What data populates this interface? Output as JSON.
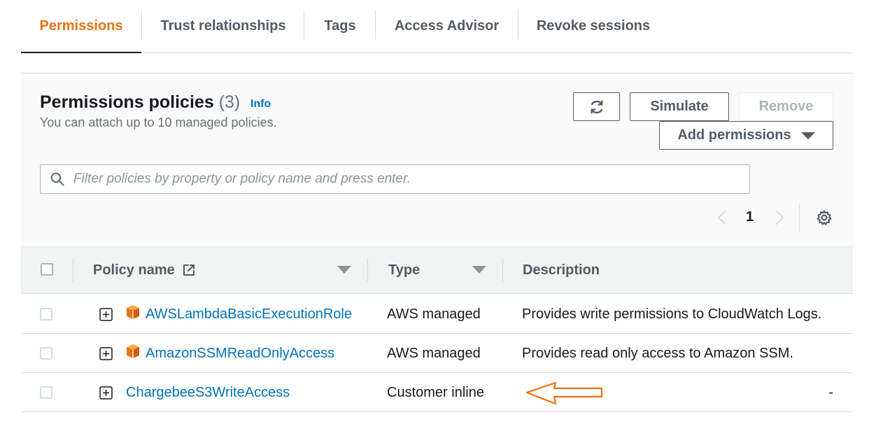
{
  "tabs": [
    {
      "label": "Permissions",
      "active": true
    },
    {
      "label": "Trust relationships",
      "active": false
    },
    {
      "label": "Tags",
      "active": false
    },
    {
      "label": "Access Advisor",
      "active": false
    },
    {
      "label": "Revoke sessions",
      "active": false
    }
  ],
  "policies": {
    "title": "Permissions policies",
    "count": "(3)",
    "info_label": "Info",
    "subtitle": "You can attach up to 10 managed policies.",
    "buttons": {
      "refresh_icon": "refresh-icon",
      "simulate": "Simulate",
      "remove": "Remove",
      "add_permissions": "Add permissions"
    },
    "search": {
      "placeholder": "Filter policies by property or policy name and press enter.",
      "value": ""
    },
    "pagination": {
      "current_page": "1"
    },
    "columns": {
      "policy_name": "Policy name",
      "type": "Type",
      "description": "Description"
    },
    "rows": [
      {
        "name": "AWSLambdaBasicExecutionRole",
        "type": "AWS managed",
        "description": "Provides write permissions to CloudWatch Logs.",
        "icon": "aws-managed-icon"
      },
      {
        "name": "AmazonSSMReadOnlyAccess",
        "type": "AWS managed",
        "description": "Provides read only access to Amazon SSM.",
        "icon": "aws-managed-icon"
      },
      {
        "name": "ChargebeeS3WriteAccess",
        "type": "Customer inline",
        "description": "-",
        "icon": ""
      }
    ]
  },
  "colors": {
    "active_tab": "#ec7211",
    "link": "#0073bb",
    "annotation_arrow": "#ec7211"
  }
}
